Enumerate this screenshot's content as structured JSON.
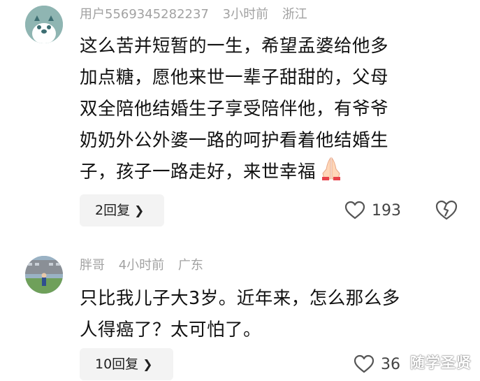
{
  "comments": [
    {
      "username": "用户5569345282237",
      "time": "3小时前",
      "location": "浙江",
      "lines": [
        "这么苦并短暂的一生，希望孟婆给他多",
        "加点糖，愿他来世一辈子甜甜的，父母",
        "双全陪他结婚生子享受陪伴他，有爷爷",
        "奶奶外公外婆一路的呵护看着他结婚生",
        "子，孩子一路走好，来世幸福"
      ],
      "emoji": "folded-hands",
      "reply_label": "2回复",
      "like_count": "193",
      "colors": {
        "avatar_bg": "#8fb5b2",
        "avatar_face": "#3d6e72"
      }
    },
    {
      "username": "胖哥",
      "time": "4小时前",
      "location": "广东",
      "lines": [
        "只比我儿子大3岁。近年来，怎么那么多",
        "人得癌了？太可怕了。"
      ],
      "reply_label": "10回复",
      "like_count": "36",
      "colors": {
        "avatar_bg": "#7fa0b5"
      }
    }
  ],
  "icons": {
    "reply_chevron": "chevron-right-icon",
    "like": "heart-outline-icon",
    "dislike": "broken-heart-outline-icon"
  },
  "watermark": "随学圣贤"
}
